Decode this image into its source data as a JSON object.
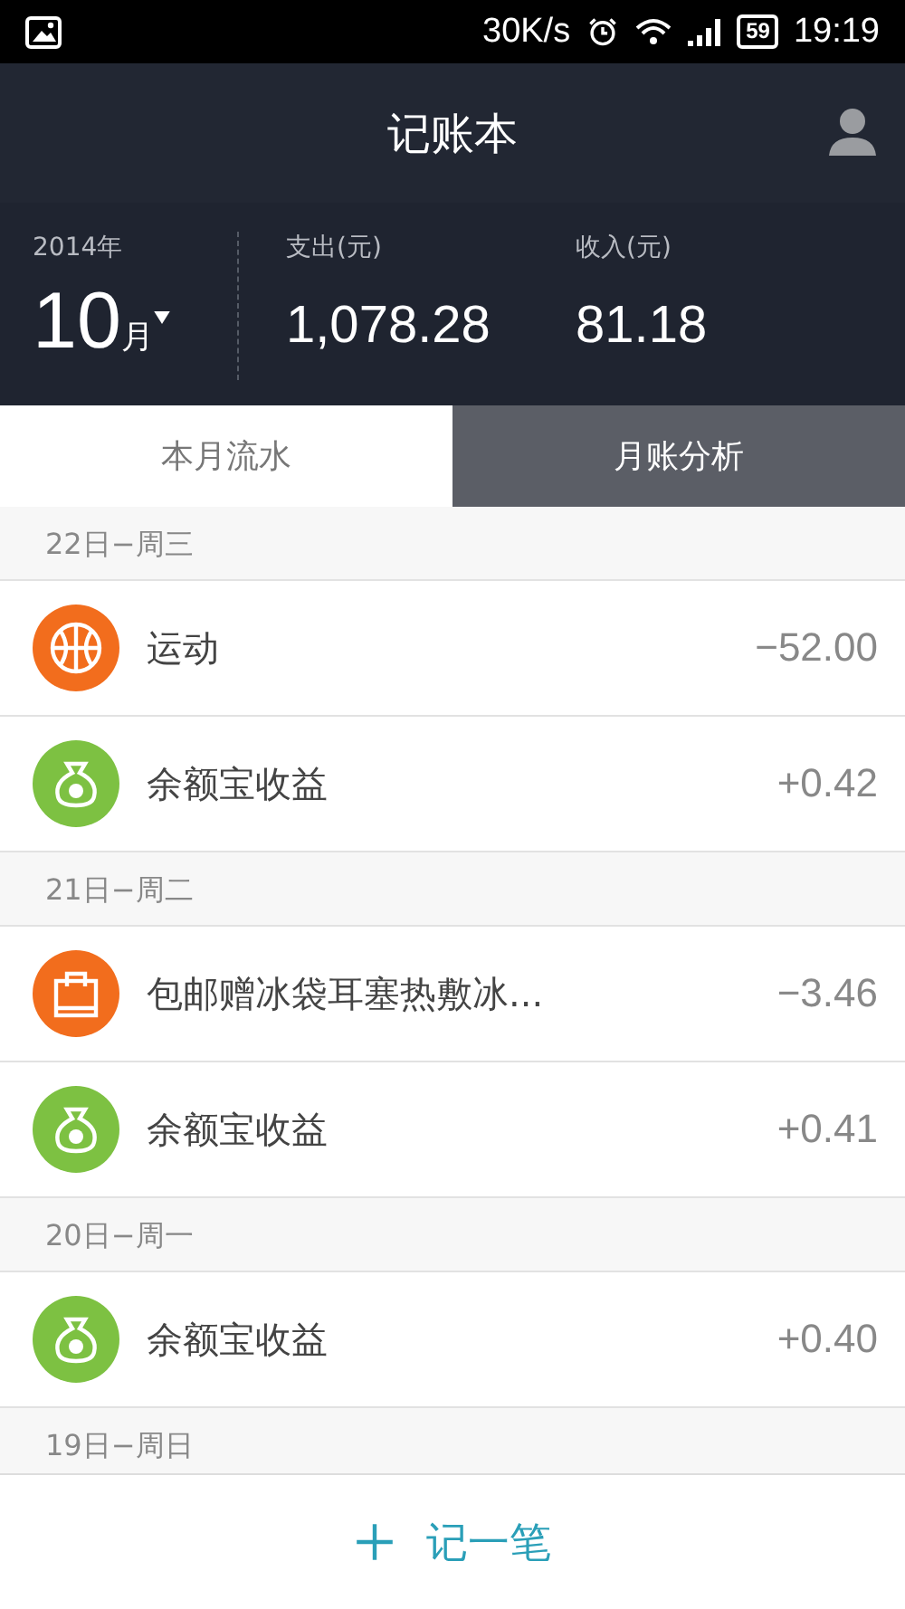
{
  "status_bar": {
    "speed": "30K/s",
    "battery": "59",
    "time": "19:19"
  },
  "header": {
    "title": "记账本"
  },
  "summary": {
    "year": "2014年",
    "month": "10",
    "month_unit": "月",
    "expense_label": "支出(元)",
    "expense": "1,078.28",
    "income_label": "收入(元)",
    "income": "81.18"
  },
  "tabs": [
    {
      "label": "本月流水",
      "selected": true
    },
    {
      "label": "月账分析",
      "selected": false
    }
  ],
  "days": [
    {
      "date": "22日−周三",
      "items": [
        {
          "kind": "sport",
          "color": "#f26d1d",
          "title": "运动",
          "amount": "−52.00"
        },
        {
          "kind": "moneybag",
          "color": "#7dc142",
          "title": "余额宝收益",
          "amount": "+0.42"
        }
      ]
    },
    {
      "date": "21日−周二",
      "items": [
        {
          "kind": "shopping",
          "color": "#f26d1d",
          "title": "包邮赠冰袋耳塞热敷冰...",
          "amount": "−3.46"
        },
        {
          "kind": "moneybag",
          "color": "#7dc142",
          "title": "余额宝收益",
          "amount": "+0.41"
        }
      ]
    },
    {
      "date": "20日−周一",
      "items": [
        {
          "kind": "moneybag",
          "color": "#7dc142",
          "title": "余额宝收益",
          "amount": "+0.40"
        }
      ]
    },
    {
      "date": "19日−周日"
    }
  ],
  "add_button": {
    "label": "记一笔"
  }
}
